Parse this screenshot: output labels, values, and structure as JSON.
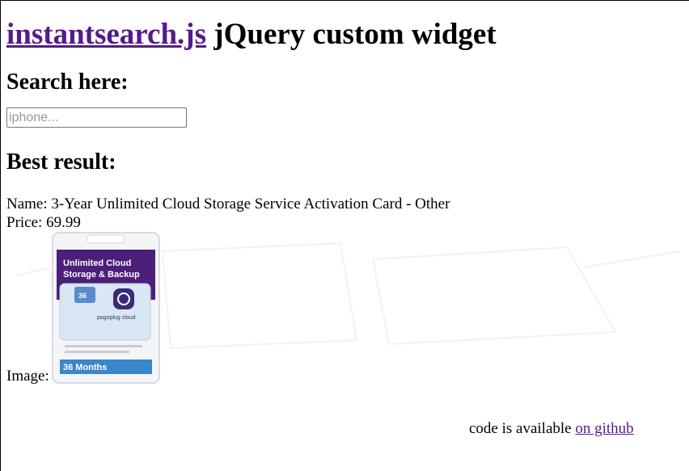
{
  "header": {
    "link_text": "instantsearch.js",
    "title_rest": " jQuery custom widget"
  },
  "search": {
    "heading": "Search here:",
    "placeholder": "iphone...",
    "value": ""
  },
  "result": {
    "heading": "Best result:",
    "name_label": "Name: ",
    "name": "3-Year Unlimited Cloud Storage Service Activation Card - Other",
    "price_label": "Price: ",
    "price": "69.99",
    "image_label": "Image:",
    "product_image": {
      "title_line1": "Unlimited Cloud",
      "title_line2": "Storage & Backup",
      "badge": "36",
      "brand": "pogoplug cloud",
      "months": "36 Months",
      "accent": "#4b1f7a"
    }
  },
  "footer": {
    "text": "code is available ",
    "link_text": "on github"
  }
}
